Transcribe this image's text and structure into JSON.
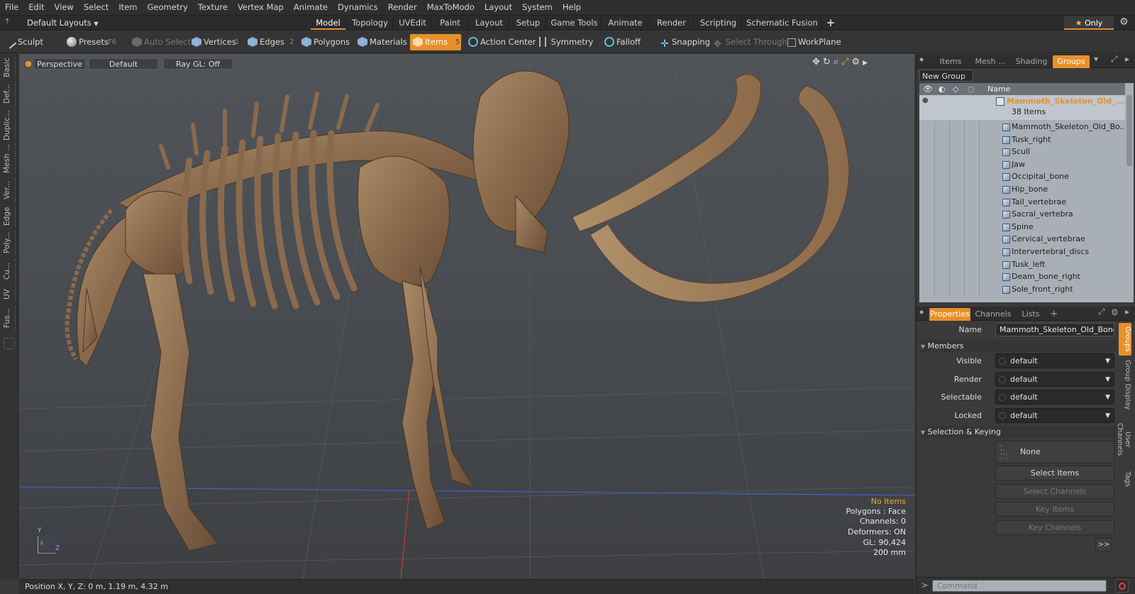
{
  "menu": [
    "File",
    "Edit",
    "View",
    "Select",
    "Item",
    "Geometry",
    "Texture",
    "Vertex Map",
    "Animate",
    "Dynamics",
    "Render",
    "MaxToModo",
    "Layout",
    "System",
    "Help"
  ],
  "layout_bar": {
    "layout_name": "Default Layouts",
    "tabs": [
      "Model",
      "Topology",
      "UVEdit",
      "Paint",
      "Layout",
      "Setup",
      "Game Tools",
      "Animate",
      "Render",
      "Scripting",
      "Schematic Fusion"
    ],
    "active_tab": "Model",
    "add_label": "+",
    "only_label": "Only"
  },
  "toolbar": {
    "sculpt": "Sculpt",
    "presets": "Presets",
    "presets_key": "F6",
    "auto_select": "Auto Select",
    "vertices": "Vertices",
    "vertices_key": "1",
    "edges": "Edges",
    "edges_key": "2",
    "polygons": "Polygons",
    "materials": "Materials",
    "items": "Items",
    "items_key": "5",
    "action_center": "Action Center",
    "symmetry": "Symmetry",
    "falloff": "Falloff",
    "snapping": "Snapping",
    "select_through": "Select Through",
    "workplane": "WorkPlane"
  },
  "left_tabs": [
    "Basic",
    "Def...",
    "Duplic...",
    "Mesh ...",
    "Ver...",
    "Edge",
    "Poly...",
    "Cu...",
    "UV",
    "Fus..."
  ],
  "viewport": {
    "view": "Perspective",
    "shading": "Default",
    "raygl": "Ray GL: Off",
    "info": {
      "no_items": "No Items",
      "polygons": "Polygons : Face",
      "channels": "Channels: 0",
      "deformers": "Deformers: ON",
      "gl": "GL: 90,424",
      "scale": "200 mm"
    },
    "axis_y": "Y",
    "axis_z": "Z",
    "axis_x": "X"
  },
  "status": {
    "position": "Position X, Y, Z:  0 m, 1.19 m, 4.32 m"
  },
  "scene_panel": {
    "tabs": [
      "Items",
      "Mesh ...",
      "Shading",
      "Groups"
    ],
    "active_tab": "Groups",
    "new_group": "New Group",
    "col_name": "Name",
    "root_name": "Mammoth_Skeleton_Old_...",
    "root_count": "38 Items",
    "items": [
      "Mammoth_Skeleton_Old_Bo...",
      "Tusk_right",
      "Scull",
      "Jaw",
      "Occipital_bone",
      "Hip_bone",
      "Tail_vertebrae",
      "Sacral_vertebra",
      "Spine",
      "Cervical_vertebrae",
      "Intervertebral_discs",
      "Tusk_left",
      "Deam_bone_right",
      "Sole_front_right"
    ]
  },
  "properties_panel": {
    "tabs": [
      "Properties",
      "Channels",
      "Lists"
    ],
    "active_tab": "Properties",
    "add_label": "+",
    "name_label": "Name",
    "name_value": "Mammoth_Skeleton_Old_Bones (",
    "members_section": "Members",
    "visible_label": "Visible",
    "visible_value": "default",
    "render_label": "Render",
    "render_value": "default",
    "selectable_label": "Selectable",
    "selectable_value": "default",
    "locked_label": "Locked",
    "locked_value": "default",
    "keying_section": "Selection & Keying",
    "none_label": "None",
    "select_items": "Select Items",
    "select_channels": "Select Channels",
    "key_items": "Key Items",
    "key_channels": "Key Channels",
    "more": ">>",
    "side_tabs": [
      "Groups",
      "Group Display",
      "User Channels",
      "Tags"
    ]
  },
  "command": {
    "placeholder": "Command",
    "prompt": ">"
  },
  "colors": {
    "accent": "#e8902a",
    "selected_item": "#e8902a",
    "tree_bg": "#a9afb6"
  }
}
